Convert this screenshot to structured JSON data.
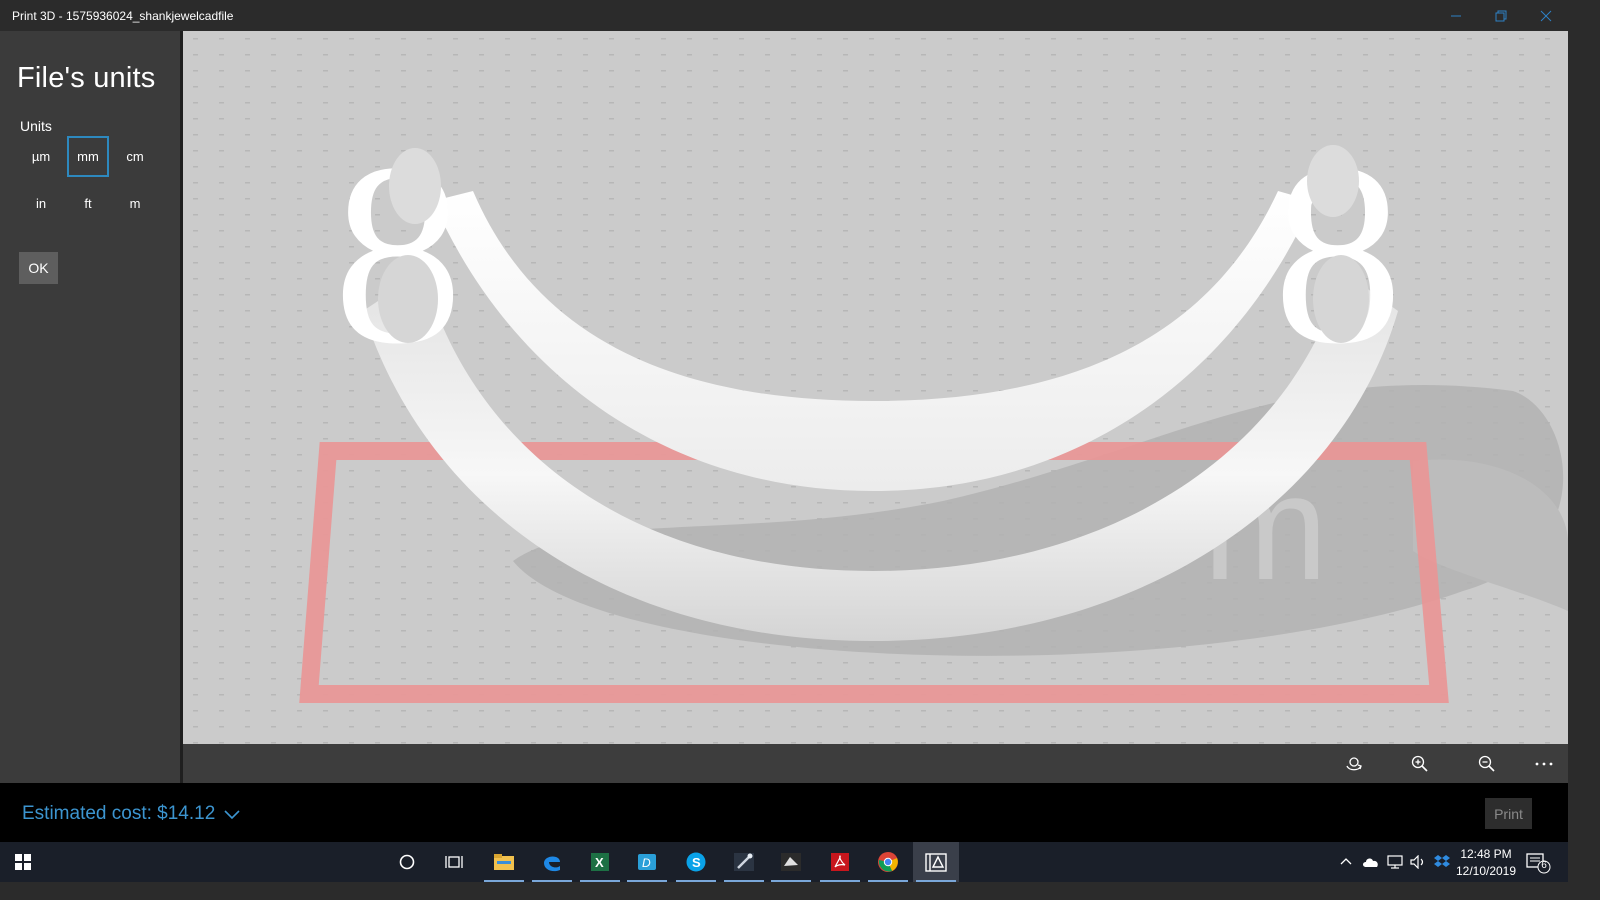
{
  "window": {
    "title": "Print 3D - 1575936024_shankjewelcadfile",
    "minimize_icon": "minimize-icon",
    "restore_icon": "restore-icon",
    "close_icon": "close-icon"
  },
  "sidebar": {
    "heading": "File's units",
    "units_label": "Units",
    "units": [
      {
        "label": "µm",
        "selected": false
      },
      {
        "label": "mm",
        "selected": true
      },
      {
        "label": "cm",
        "selected": false
      },
      {
        "label": "in",
        "selected": false
      },
      {
        "label": "ft",
        "selected": false
      },
      {
        "label": "m",
        "selected": false
      }
    ],
    "ok_label": "OK"
  },
  "toolbar": {
    "icons": [
      "rotate-view-icon",
      "zoom-in-icon",
      "zoom-out-icon",
      "more-icon"
    ]
  },
  "footer": {
    "estimated_cost": "Estimated cost: $14.12",
    "print_label": "Print"
  },
  "colors": {
    "accent": "#3c95d0",
    "selected_border": "#2d89bf",
    "bed_outline": "#e89797",
    "viewport_bg": "#cbcbcb"
  },
  "taskbar": {
    "apps": [
      "start-icon",
      "cortana-icon",
      "task-view-icon",
      "file-explorer-icon",
      "edge-icon",
      "excel-icon",
      "app-icon",
      "skype-icon",
      "tool-icon",
      "app-icon-2",
      "acrobat-icon",
      "chrome-icon",
      "print3d-icon"
    ],
    "time": "12:48 PM",
    "date": "12/10/2019",
    "notification_count": "6"
  }
}
